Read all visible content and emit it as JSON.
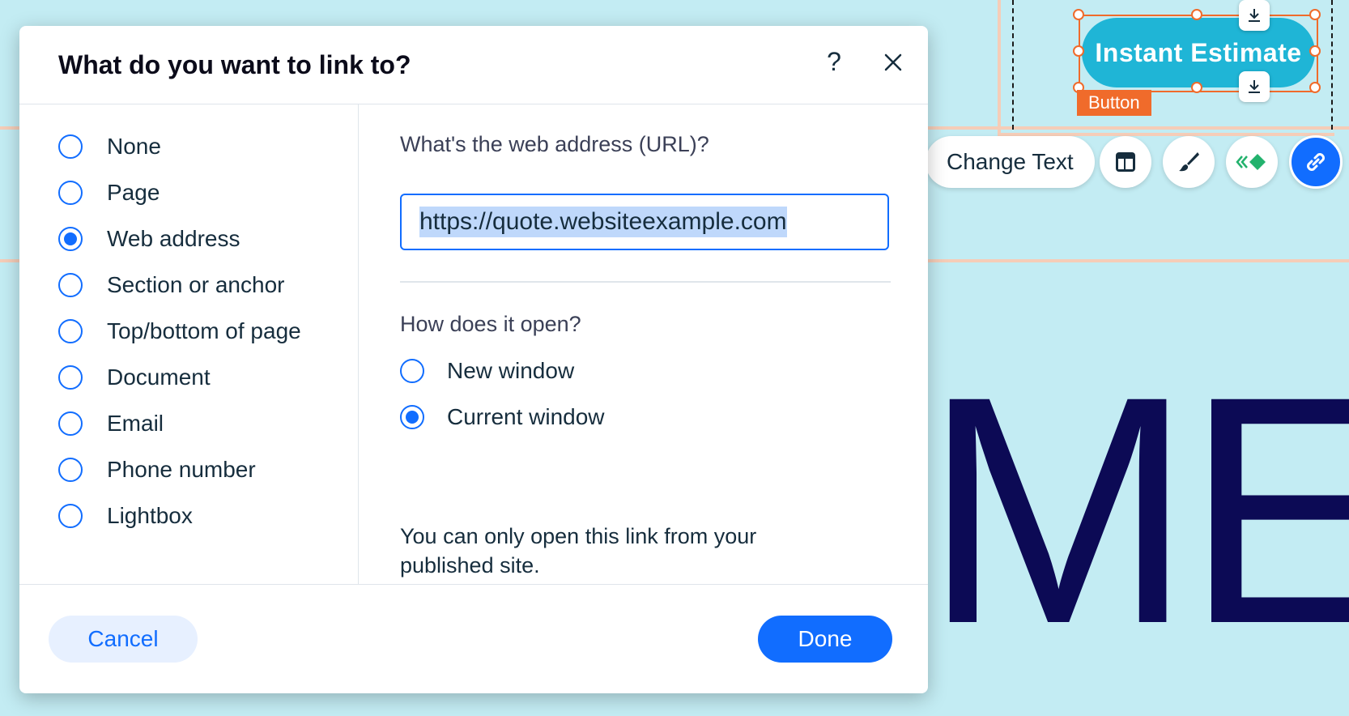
{
  "dialog": {
    "title": "What do you want to link to?",
    "help_label": "?",
    "link_options": [
      {
        "label": "None",
        "selected": false
      },
      {
        "label": "Page",
        "selected": false
      },
      {
        "label": "Web address",
        "selected": true
      },
      {
        "label": "Section or anchor",
        "selected": false
      },
      {
        "label": "Top/bottom of page",
        "selected": false
      },
      {
        "label": "Document",
        "selected": false
      },
      {
        "label": "Email",
        "selected": false
      },
      {
        "label": "Phone number",
        "selected": false
      },
      {
        "label": "Lightbox",
        "selected": false
      }
    ],
    "url_label": "What's the web address (URL)?",
    "url_value": "https://quote.websiteexample.com",
    "open_label": "How does it open?",
    "open_options": [
      {
        "label": "New window",
        "selected": false
      },
      {
        "label": "Current window",
        "selected": true
      }
    ],
    "note": "You can only open this link from your published site.",
    "cancel_label": "Cancel",
    "done_label": "Done"
  },
  "canvas": {
    "button_text": "Instant Estimate",
    "button_tag": "Button",
    "change_text_label": "Change Text",
    "big_text": "ME",
    "toolbar_icons": [
      "layout-icon",
      "paintbrush-icon",
      "animation-icon",
      "link-icon"
    ]
  },
  "colors": {
    "accent": "#116dff",
    "canvas_bg": "#c3ecf3",
    "button_bg": "#1fb5d6",
    "selection": "#f06b2b",
    "big_text": "#0c0a55"
  }
}
